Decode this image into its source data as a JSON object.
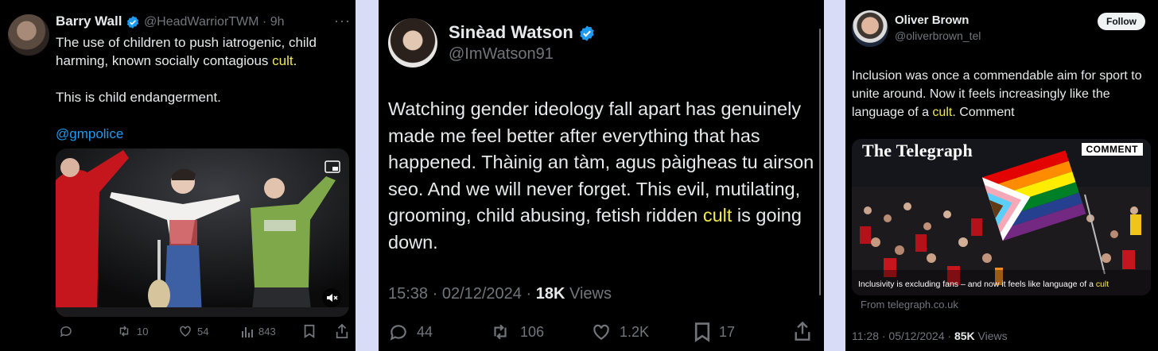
{
  "tweet1": {
    "name": "Barry Wall",
    "handle": "@HeadWarriorTWM",
    "time": "9h",
    "text_a": "The use of children to push iatrogenic,  child harming,  known socially contagious ",
    "text_hl": "cult",
    "text_b": ".\n\nThis is child endangerment.",
    "mention": "@gmpolice",
    "replies": "",
    "retweets": "10",
    "likes": "54",
    "views": "843"
  },
  "tweet2": {
    "name": "Sinèad Watson",
    "handle": "@ImWatson91",
    "text_a": "Watching gender ideology fall apart has genuinely made me feel better after everything that has happened. Thàinig an tàm, agus pàigheas tu airson seo. And we will never forget. This evil, mutilating, grooming, child abusing, fetish ridden ",
    "text_hl": "cult",
    "text_b": " is going down.",
    "timestamp": "15:38 · 02/12/2024 · ",
    "views_count": "18K",
    "views_label": " Views",
    "replies": "44",
    "retweets": "106",
    "likes": "1.2K",
    "bookmarks": "17"
  },
  "tweet3": {
    "name": "Oliver Brown",
    "handle": "@oliverbrown_tel",
    "follow_label": "Follow",
    "text_a": "Inclusion was once a commendable aim for sport to unite around. Now it feels increasingly like the language of a ",
    "text_hl": "cult",
    "text_b": ". Comment",
    "card_logo": "The Telegraph",
    "card_tag": "COMMENT",
    "card_caption_a": "Inclusivity is excluding fans – and now it feels like language of a ",
    "card_caption_hl": "cult",
    "card_source": "From telegraph.co.uk",
    "timestamp": "11:28 · 05/12/2024 · ",
    "views_count": "85K",
    "views_label": " Views"
  },
  "colors": {
    "background": "#000000",
    "text": "#e7e9ea",
    "muted": "#71767b",
    "highlight": "#f2e94e",
    "link": "#1d9bf0",
    "verified": "#1d9bf0",
    "page_bg": "#d9dcf7"
  },
  "icons": [
    "verified-badge-icon",
    "more-icon",
    "reply-icon",
    "retweet-icon",
    "like-icon",
    "views-icon",
    "bookmark-icon",
    "share-icon",
    "mute-icon",
    "picture-in-picture-icon"
  ]
}
